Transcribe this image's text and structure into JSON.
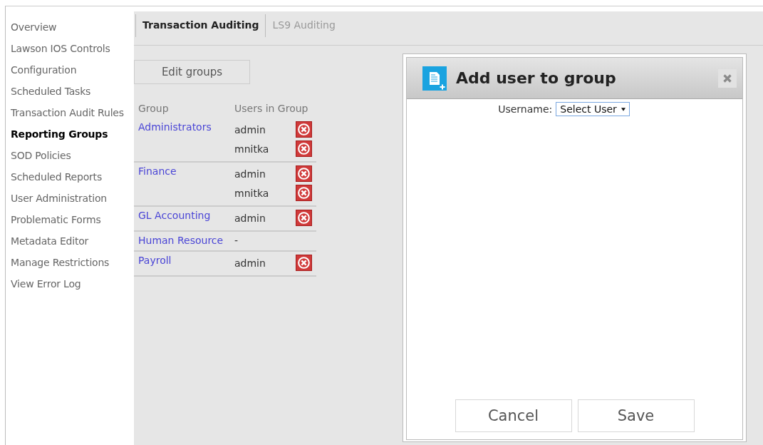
{
  "sidebar": {
    "items": [
      {
        "label": "Overview",
        "selected": false
      },
      {
        "label": "Lawson IOS Controls",
        "selected": false
      },
      {
        "label": "Configuration",
        "selected": false
      },
      {
        "label": "Scheduled Tasks",
        "selected": false
      },
      {
        "label": "Transaction Audit Rules",
        "selected": false
      },
      {
        "label": "Reporting Groups",
        "selected": true
      },
      {
        "label": "SOD Policies",
        "selected": false
      },
      {
        "label": "Scheduled Reports",
        "selected": false
      },
      {
        "label": "User Administration",
        "selected": false
      },
      {
        "label": "Problematic Forms",
        "selected": false
      },
      {
        "label": "Metadata Editor",
        "selected": false
      },
      {
        "label": "Manage Restrictions",
        "selected": false
      },
      {
        "label": "View Error Log",
        "selected": false
      }
    ]
  },
  "tabs": [
    {
      "label": "Transaction Auditing",
      "selected": true
    },
    {
      "label": "LS9 Auditing",
      "selected": false
    }
  ],
  "edit_button": "Edit groups",
  "table": {
    "columns": [
      "Group",
      "Users in Group"
    ],
    "rows": [
      {
        "group": "Administrators",
        "users": [
          "admin",
          "mnitka"
        ]
      },
      {
        "group": "Finance",
        "users": [
          "admin",
          "mnitka"
        ]
      },
      {
        "group": "GL Accounting",
        "users": [
          "admin"
        ]
      },
      {
        "group": "Human Resource",
        "empty": "-",
        "users": []
      },
      {
        "group": "Payroll",
        "users": [
          "admin"
        ]
      }
    ]
  },
  "dialog": {
    "title": "Add user to group",
    "username_label": "Username:",
    "select_value": "Select User",
    "buttons": [
      "Cancel",
      "Save"
    ]
  }
}
